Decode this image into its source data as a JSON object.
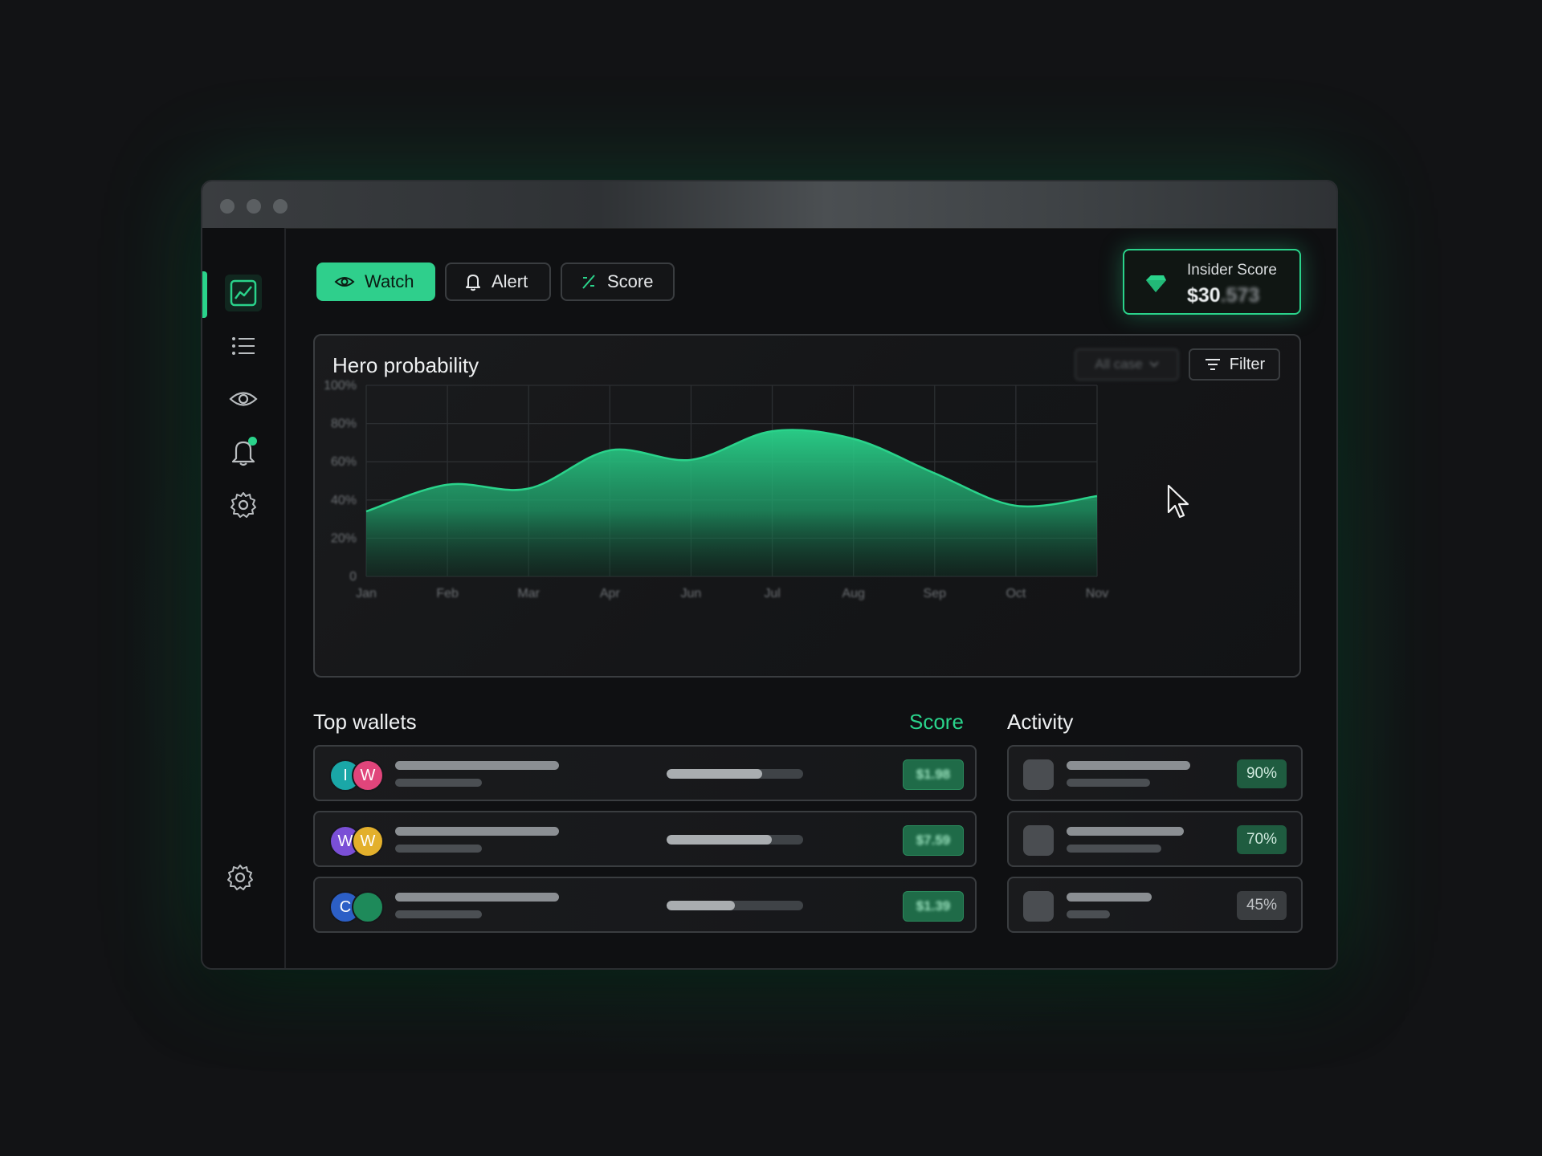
{
  "toolbar": {
    "watch_label": "Watch",
    "alert_label": "Alert",
    "score_label": "Score"
  },
  "insider": {
    "label": "Insider Score",
    "value_main": "$30",
    "value_faded": ".573"
  },
  "chart": {
    "title": "Hero probability",
    "range_select": "All case",
    "filter_label": "Filter"
  },
  "chart_data": {
    "type": "area",
    "x": [
      "Jan",
      "Feb",
      "Mar",
      "Apr",
      "Jun",
      "Jul",
      "Aug",
      "Sep",
      "Oct",
      "Nov"
    ],
    "series": [
      {
        "values": [
          34,
          48,
          46,
          66,
          61,
          76,
          72,
          54,
          37,
          42
        ]
      }
    ],
    "y_ticks": [
      "100%",
      "80%",
      "60%",
      "40%",
      "20%",
      "0"
    ],
    "ylim": [
      0,
      100
    ],
    "grid": true,
    "color": "#2ad38b"
  },
  "wallets": {
    "title": "Top wallets",
    "score_header": "Score",
    "rows": [
      {
        "avatars": [
          "I",
          "W"
        ],
        "avatar_colors": [
          "#1aa7a7",
          "#e0457b"
        ],
        "progress": 0.7,
        "value": "$1.98"
      },
      {
        "avatars": [
          "W",
          "W"
        ],
        "avatar_colors": [
          "#7a4fd6",
          "#e3b02c"
        ],
        "progress": 0.77,
        "value": "$7.59"
      },
      {
        "avatars": [
          "C",
          ""
        ],
        "avatar_colors": [
          "#2c5fc6",
          "#1e8a5a"
        ],
        "progress": 0.5,
        "value": "$1.39"
      }
    ]
  },
  "activity": {
    "title": "Activity",
    "rows": [
      {
        "percent": "90%",
        "tone": "green"
      },
      {
        "percent": "70%",
        "tone": "green"
      },
      {
        "percent": "45%",
        "tone": "grey"
      }
    ]
  }
}
